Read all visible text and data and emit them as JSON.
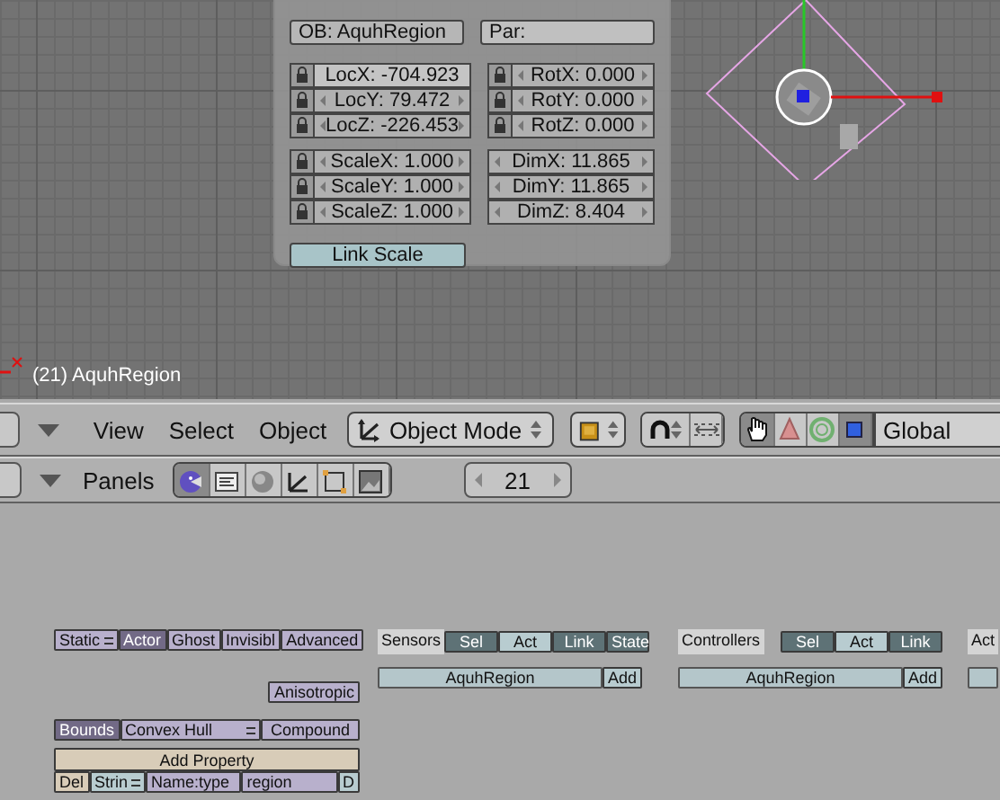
{
  "viewport": {
    "object_label": "(21) AquhRegion"
  },
  "transform_panel": {
    "object_field": "OB: AquhRegion",
    "parent_field": "Par:",
    "groups": [
      {
        "kind": "lockable",
        "fields": [
          {
            "label": "LocX: -704.923",
            "hovered": true
          },
          {
            "label": "LocY: 79.472",
            "hovered": false
          },
          {
            "label": "LocZ: -226.453",
            "hovered": false
          }
        ]
      },
      {
        "kind": "lockable",
        "fields": [
          {
            "label": "RotX: 0.000",
            "hovered": false
          },
          {
            "label": "RotY: 0.000",
            "hovered": false
          },
          {
            "label": "RotZ: 0.000",
            "hovered": false
          }
        ]
      },
      {
        "kind": "lockable",
        "fields": [
          {
            "label": "ScaleX: 1.000",
            "hovered": false
          },
          {
            "label": "ScaleY: 1.000",
            "hovered": false
          },
          {
            "label": "ScaleZ: 1.000",
            "hovered": false
          }
        ]
      },
      {
        "kind": "plain",
        "fields": [
          {
            "label": "DimX: 11.865",
            "hovered": false
          },
          {
            "label": "DimY: 11.865",
            "hovered": false
          },
          {
            "label": "DimZ: 8.404",
            "hovered": false
          }
        ]
      }
    ],
    "link_scale": "Link Scale"
  },
  "header": {
    "menus": [
      "View",
      "Select",
      "Object"
    ],
    "mode": "Object Mode",
    "manipulators": [
      {
        "kind": "hand",
        "selected": true
      },
      {
        "kind": "translate",
        "selected": false
      },
      {
        "kind": "rotate",
        "selected": false
      },
      {
        "kind": "scale",
        "selected": true
      }
    ],
    "orientation": "Global"
  },
  "buttons_header": {
    "label": "Panels",
    "context_buttons": [
      {
        "kind": "logic",
        "selected": true
      },
      {
        "kind": "script",
        "selected": false
      },
      {
        "kind": "shading",
        "selected": false
      },
      {
        "kind": "object",
        "selected": false
      },
      {
        "kind": "editing",
        "selected": false
      },
      {
        "kind": "scene",
        "selected": false
      }
    ],
    "frame": "21"
  },
  "logic": {
    "physics": {
      "type": "Static",
      "toggles": [
        {
          "label": "Actor",
          "selected": true
        },
        {
          "label": "Ghost",
          "selected": false
        },
        {
          "label": "Invisibl",
          "selected": false
        },
        {
          "label": "Advanced",
          "selected": false
        }
      ],
      "anisotropic": "Anisotropic",
      "bounds": {
        "label": "Bounds",
        "selected": true
      },
      "bounds_type": "Convex Hull",
      "compound": "Compound",
      "add_property": "Add Property",
      "property": {
        "delete": "Del",
        "type": "Strin",
        "name": "Name:type",
        "value": "region",
        "debug": "D"
      }
    },
    "columns": [
      {
        "title": "Sensors",
        "filters": [
          {
            "label": "Sel",
            "selected": true
          },
          {
            "label": "Act",
            "selected": false
          },
          {
            "label": "Link",
            "selected": true
          },
          {
            "label": "State",
            "selected": true
          }
        ],
        "object": "AquhRegion",
        "add": "Add"
      },
      {
        "title": "Controllers",
        "filters": [
          {
            "label": "Sel",
            "selected": true
          },
          {
            "label": "Act",
            "selected": false
          },
          {
            "label": "Link",
            "selected": true
          }
        ],
        "object": "AquhRegion",
        "add": "Add"
      },
      {
        "title": "Act"
      }
    ]
  }
}
